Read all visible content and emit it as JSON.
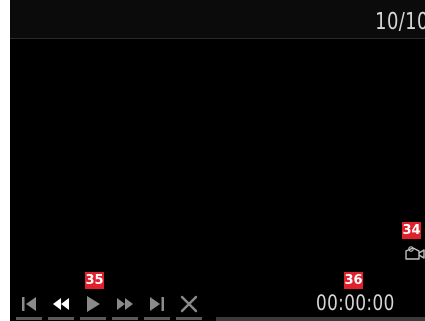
{
  "header": {
    "counter": "10/10"
  },
  "callouts": {
    "camera": "34",
    "controls": "35",
    "time": "36"
  },
  "playback": {
    "timecode": "00:00:00",
    "buttons": [
      {
        "name": "skip-to-start-button",
        "icon": "skip-to-start-icon"
      },
      {
        "name": "rewind-button",
        "icon": "rewind-icon",
        "active": true
      },
      {
        "name": "play-button",
        "icon": "play-icon"
      },
      {
        "name": "fast-forward-button",
        "icon": "fast-forward-icon"
      },
      {
        "name": "skip-to-end-button",
        "icon": "skip-to-end-icon"
      },
      {
        "name": "close-button",
        "icon": "close-icon"
      }
    ],
    "progress": 0
  },
  "icons": {
    "camera": "video-camera-icon"
  },
  "colors": {
    "background": "#000000",
    "text": "#d6d6d6",
    "icon_dim": "#8a8a8a",
    "icon_active": "#ffffff",
    "callout": "#e0202c"
  }
}
